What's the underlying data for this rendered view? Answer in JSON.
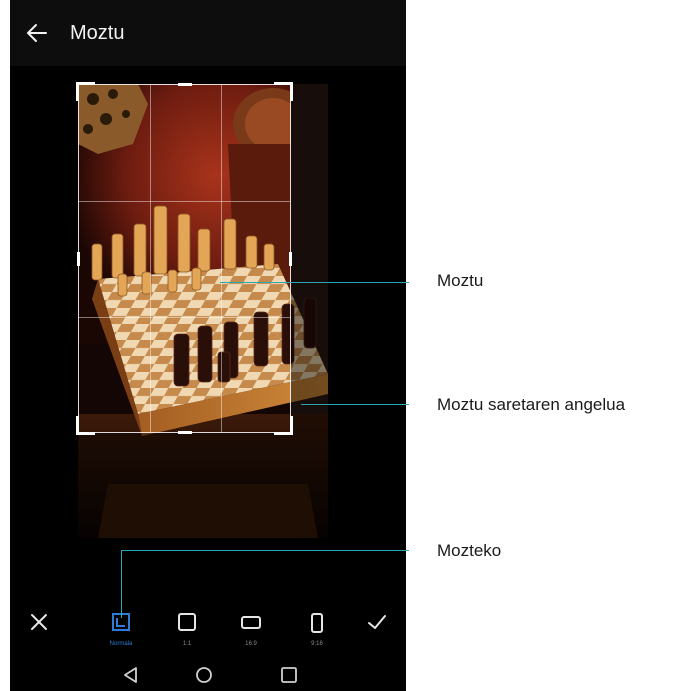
{
  "topbar": {
    "back_icon": "arrow-left-icon",
    "title": "Moztu"
  },
  "toolbar": {
    "cancel_icon": "close-icon",
    "confirm_icon": "check-icon",
    "ratios": [
      {
        "label": "Normala",
        "icon": "crop-free-icon",
        "active": true
      },
      {
        "label": "1:1",
        "icon": "square-ratio-icon",
        "active": false
      },
      {
        "label": "16:9",
        "icon": "landscape-ratio-icon",
        "active": false
      },
      {
        "label": "9:16",
        "icon": "portrait-ratio-icon",
        "active": false
      }
    ]
  },
  "navbar": {
    "back_icon": "nav-back-icon",
    "home_icon": "nav-home-icon",
    "recents_icon": "nav-recents-icon"
  },
  "callouts": {
    "crop": "Moztu",
    "crop_corner": "Moztu saretaren angelua",
    "crop_modes": "Mozteko"
  },
  "colors": {
    "accent": "#2f7bd8",
    "callout_line": "#2aa6b4"
  }
}
